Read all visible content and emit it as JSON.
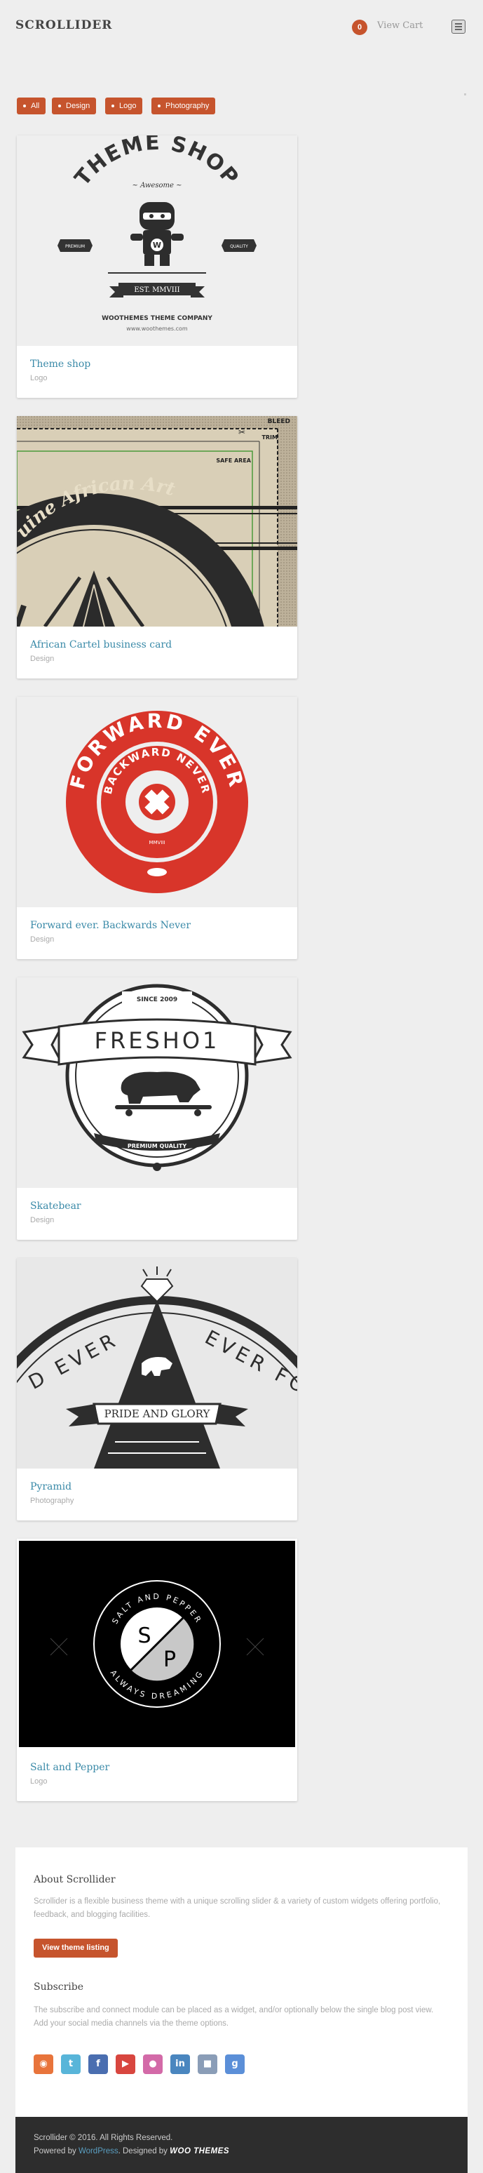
{
  "header": {
    "logo": "SCROLLIDER",
    "cart_count": "0",
    "cart_label": "View Cart"
  },
  "filters": [
    "All",
    "Design",
    "Logo",
    "Photography"
  ],
  "portfolio": [
    {
      "title": "Theme shop",
      "category": "Logo",
      "art": {
        "headline": "THEME SHOP",
        "tagline": "~ Awesome ~",
        "left_badge": "PREMIUM",
        "right_badge": "QUALITY",
        "mascot_letter": "W",
        "banner": "EST. MMVIII",
        "company": "WOOTHEMES THEME COMPANY",
        "url": "www.woothemes.com"
      }
    },
    {
      "title": "African Cartel business card",
      "category": "Design",
      "art": {
        "bleed": "BLEED",
        "trim": "TRIM",
        "safe": "SAFE AREA",
        "arc_text": "uine African Art"
      }
    },
    {
      "title": "Forward ever. Backwards Never",
      "category": "Design",
      "art": {
        "outer_text": "FORWARD EVER",
        "inner_text": "BACKWARD NEVER",
        "year": "MMVIII"
      }
    },
    {
      "title": "Skatebear",
      "category": "Design",
      "art": {
        "since": "SINCE 2009",
        "banner": "FRESHO1",
        "quality": "PREMIUM QUALITY"
      }
    },
    {
      "title": "Pyramid",
      "category": "Photography",
      "art": {
        "left_text": "D EVER",
        "right_text": "EVER FO",
        "banner": "PRIDE AND GLORY"
      }
    },
    {
      "title": "Salt and Pepper",
      "category": "Logo",
      "art": {
        "top_text": "SALT AND PEPPER",
        "bottom_text": "ALWAYS DREAMING",
        "left_letter": "S",
        "right_letter": "P"
      }
    }
  ],
  "about": {
    "title": "About Scrollider",
    "text": "Scrollider is a flexible business theme with a unique scrolling slider & a variety of custom widgets offering portfolio, feedback, and blogging facilities.",
    "button": "View theme listing"
  },
  "subscribe": {
    "title": "Subscribe",
    "text": "The subscribe and connect module can be placed as a widget, and/or optionally below the single blog post view. Add your social media channels via the theme options."
  },
  "social_icons": [
    {
      "name": "rss-icon",
      "color": "#e8743b",
      "glyph": "◉"
    },
    {
      "name": "twitter-icon",
      "color": "#58b5d9",
      "glyph": "t"
    },
    {
      "name": "facebook-icon",
      "color": "#4a6eb0",
      "glyph": "f"
    },
    {
      "name": "youtube-icon",
      "color": "#d8463f",
      "glyph": "▶"
    },
    {
      "name": "flickr-icon",
      "color": "#d36aa8",
      "glyph": "●"
    },
    {
      "name": "linkedin-icon",
      "color": "#4a86bf",
      "glyph": "in"
    },
    {
      "name": "delicious-icon",
      "color": "#8a9db7",
      "glyph": "■"
    },
    {
      "name": "googleplus-icon",
      "color": "#5b8fd8",
      "glyph": "g"
    }
  ],
  "footer": {
    "copyright": "Scrollider © 2016. All Rights Reserved.",
    "powered_prefix": "Powered by",
    "powered_link": "WordPress",
    "designed_by": ". Designed by",
    "designer": "WOO THEMES"
  },
  "colors": {
    "accent": "#c6542d",
    "link": "#3a8aa8",
    "footer_bg": "#2d2d2d"
  }
}
